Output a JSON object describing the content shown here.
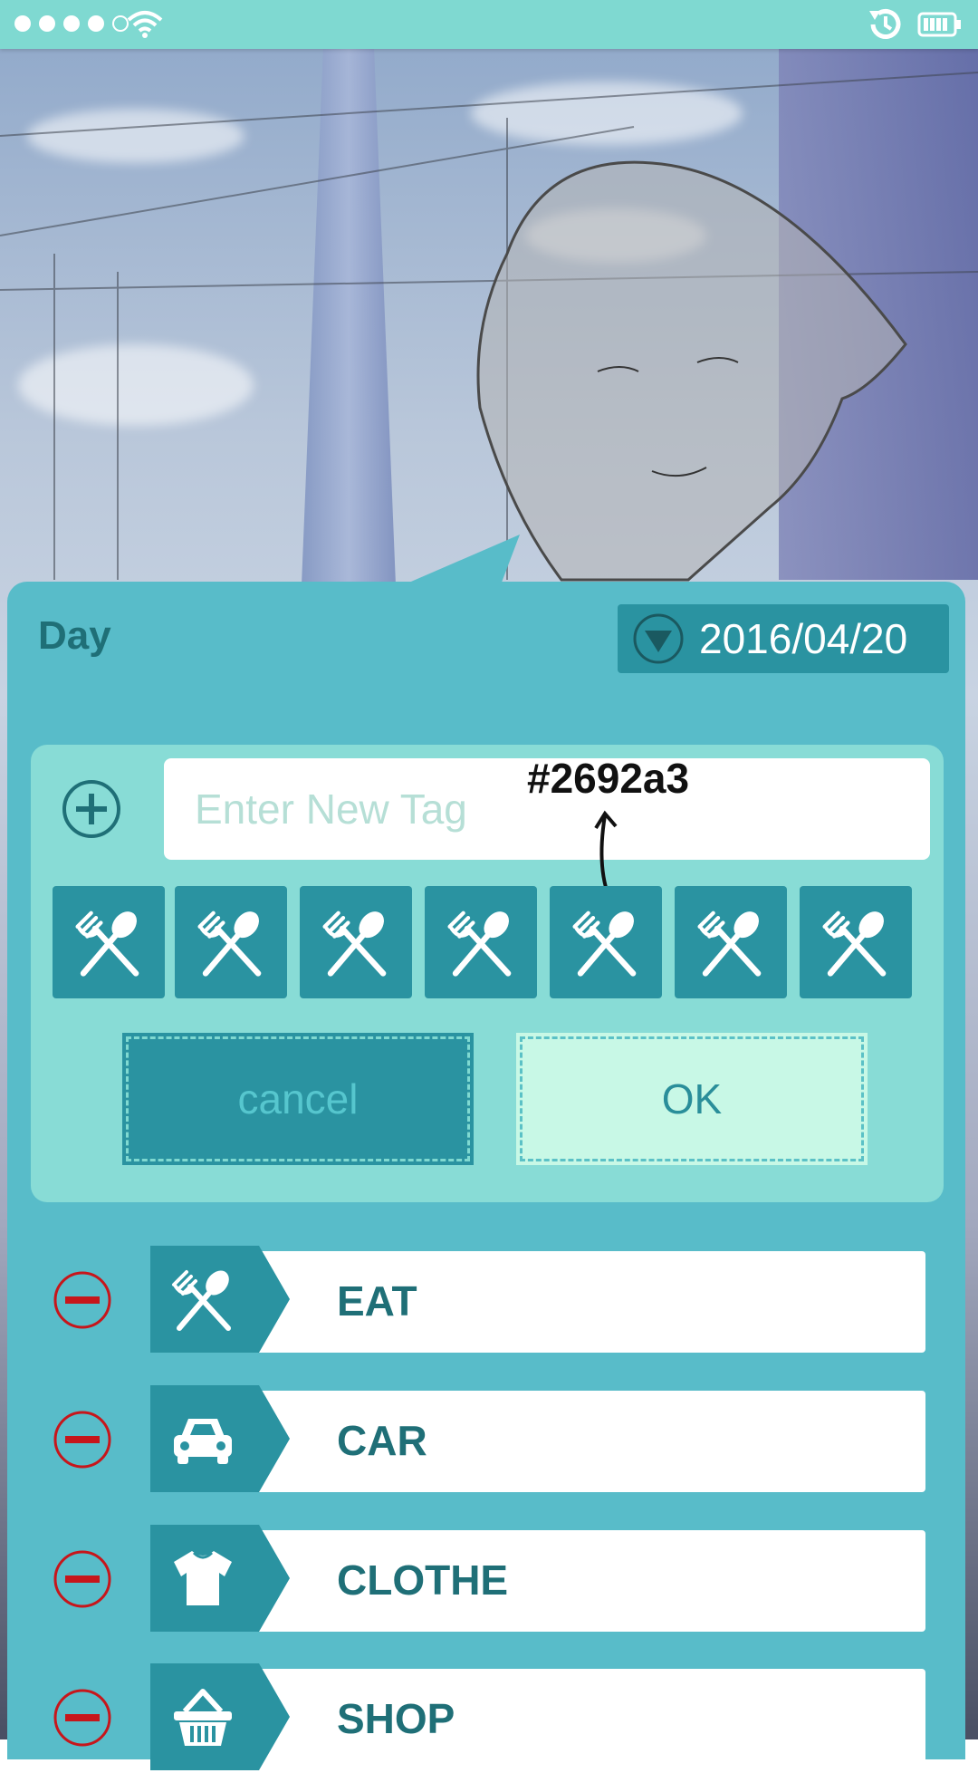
{
  "colors": {
    "status_bar": "#7fd9d1",
    "panel": "#58bcc9",
    "editor": "#88dcd6",
    "accent_dark": "#2a93a1",
    "ok_bg": "#c8f8e6",
    "minus_red": "#c7161b",
    "text_dark": "#1f6f77"
  },
  "status": {
    "signal_icons": [
      "dot-filled",
      "dot-filled",
      "dot-filled",
      "dot-filled",
      "dot-hollow"
    ],
    "right_icons": [
      "sync-icon",
      "battery-icon"
    ]
  },
  "header": {
    "day_label": "Day",
    "date": "2016/04/20",
    "date_icon": "dropdown-triangle-icon"
  },
  "editor": {
    "add_icon": "plus-circle-icon",
    "input_placeholder": "Enter New Tag",
    "annotation": "#2692a3",
    "icon_choices": [
      "fork-spoon-icon",
      "fork-spoon-icon",
      "fork-spoon-icon",
      "fork-spoon-icon",
      "fork-spoon-icon",
      "fork-spoon-icon",
      "fork-spoon-icon"
    ],
    "cancel_label": "cancel",
    "ok_label": "OK"
  },
  "tags": [
    {
      "label": "EAT",
      "icon": "fork-spoon-icon"
    },
    {
      "label": "CAR",
      "icon": "car-icon"
    },
    {
      "label": "CLOTHE",
      "icon": "shirt-icon"
    },
    {
      "label": "SHOP",
      "icon": "basket-icon"
    }
  ]
}
